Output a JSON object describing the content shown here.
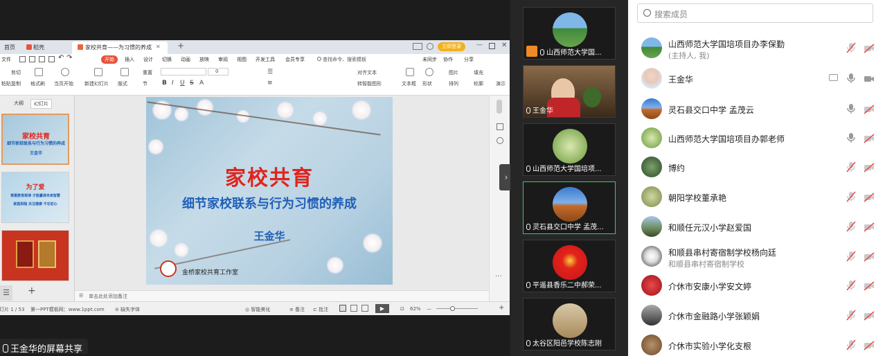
{
  "share_label": "王金华的屏幕共享",
  "ppt": {
    "tabs": [
      "首页",
      "稻壳",
      "家校共育——为习惯的养成"
    ],
    "login_btn": "立即登录",
    "menus": [
      "文件",
      "开始",
      "插入",
      "设计",
      "切换",
      "动画",
      "放映",
      "审阅",
      "视图",
      "开发工具",
      "会员专享"
    ],
    "search_cmd": "查找命令、搜索模板",
    "right_menus": [
      "未同步",
      "协作",
      "分享"
    ],
    "ribbon": {
      "paste": "粘贴",
      "cut": "剪切",
      "copy": "复制",
      "format_painter": "格式刷",
      "play_from_current": "当页开始",
      "new_slide": "新建幻灯片",
      "layout": "版式",
      "section": "节",
      "reset": "重置",
      "font_size": "0",
      "text_box": "文本框",
      "shape": "形状",
      "arrange": "排列",
      "image": "图片",
      "fill": "填充",
      "outline": "轮廓",
      "align_text": "对齐文本",
      "smart_convert": "转智能图形",
      "play": "演示"
    },
    "pane_tabs": [
      "大纲",
      "幻灯片"
    ],
    "thumb1_title": "家校共育",
    "thumb1_sub": "细节家校联系与行为习惯的养成",
    "thumb1_author": "王金华",
    "thumb2_title": "为了爱",
    "thumb2_sub": "尊重教育规律 才能赢得未来智慧",
    "thumb2_line": "家庭和睦 关注健康 不忘初心",
    "slide": {
      "title": "家校共育",
      "subtitle": "细节家校联系与行为习惯的养成",
      "author": "王金华",
      "studio": "金桥家校共育工作室"
    },
    "notes_hint": "单击此处添加备注",
    "status": {
      "page": "幻灯片 1 / 53",
      "template": "第一PPT模板网：www.1ppt.com",
      "missing_font": "缺失字体",
      "smart_beautify": "智能美化",
      "notes": "备注",
      "comments": "批注",
      "zoom": "62%"
    }
  },
  "videos": [
    {
      "name": "山西师范大学国..."
    },
    {
      "name": "王金华"
    },
    {
      "name": "山西师范大学国培项..."
    },
    {
      "name": "灵石县交口中学 孟茂..."
    },
    {
      "name": "平遥县香乐二中郝荣..."
    },
    {
      "name": "太谷区阳邑学校陈志刚"
    }
  ],
  "members": {
    "search_placeholder": "搜索成员",
    "list": [
      {
        "name": "山西师范大学国培项目办李保勤",
        "sub": "(主持人, 我)",
        "mic": "muted",
        "cam": "off"
      },
      {
        "name": "王金华",
        "sub": "",
        "mic": "on",
        "cam": "on",
        "share": true
      },
      {
        "name": "灵石县交口中学 孟茂云",
        "sub": "",
        "mic": "on",
        "cam": "off"
      },
      {
        "name": "山西师范大学国培项目办郭老师",
        "sub": "",
        "mic": "on",
        "cam": "off"
      },
      {
        "name": "博约",
        "sub": "",
        "mic": "muted",
        "cam": "off"
      },
      {
        "name": "朝阳学校董承艳",
        "sub": "",
        "mic": "muted",
        "cam": "off"
      },
      {
        "name": "和顺任元汉小学赵爱国",
        "sub": "",
        "mic": "muted",
        "cam": "off"
      },
      {
        "name": "和顺县串村寄宿制学校杨向廷",
        "sub": "和顺县串村寄宿制学校",
        "mic": "muted",
        "cam": "off"
      },
      {
        "name": "介休市安康小学安文婷",
        "sub": "",
        "mic": "muted",
        "cam": "off"
      },
      {
        "name": "介休市金融路小学张颖娟",
        "sub": "",
        "mic": "muted",
        "cam": "off"
      },
      {
        "name": "介休市实验小学化支根",
        "sub": "",
        "mic": "muted",
        "cam": "off"
      }
    ]
  },
  "colors": {
    "accent_orange": "#e8523a",
    "active_green": "#3ec86a",
    "muted_red": "#e84c4c",
    "slide_title_red": "#e0241c",
    "slide_sub_blue": "#1f5fb8"
  }
}
